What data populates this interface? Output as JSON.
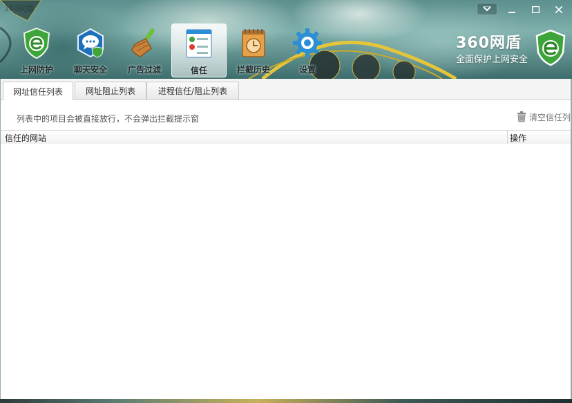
{
  "window": {
    "title": "360网盾"
  },
  "nav": {
    "items": [
      {
        "label": "上网防护",
        "icon": "shield-e-icon"
      },
      {
        "label": "聊天安全",
        "icon": "chat-shield-icon"
      },
      {
        "label": "广告过滤",
        "icon": "broom-icon"
      },
      {
        "label": "信任",
        "icon": "trust-list-icon",
        "active": true
      },
      {
        "label": "拦截历史",
        "icon": "history-clock-icon"
      },
      {
        "label": "设置",
        "icon": "gear-icon"
      }
    ]
  },
  "brand": {
    "name": "360网盾",
    "slogan": "全面保护上网安全"
  },
  "tabs": [
    {
      "label": "网址信任列表",
      "active": true
    },
    {
      "label": "网址阻止列表"
    },
    {
      "label": "进程信任/阻止列表"
    }
  ],
  "info_text": "列表中的项目会被直接放行，不会弹出拦截提示窗",
  "clear_button": "清空信任列",
  "table": {
    "columns": [
      "信任的网站",
      "操作"
    ],
    "rows": []
  },
  "colors": {
    "accent": "#2a8fd6",
    "banner": "#5c8f8d",
    "rail": "#e5c53a"
  }
}
